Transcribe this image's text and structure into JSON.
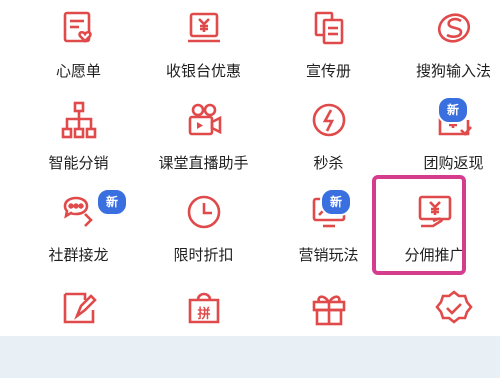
{
  "colors": {
    "icon": "#e04a4a",
    "badge": "#3a6fe0",
    "highlight": "#d63c8d"
  },
  "items": [
    {
      "label": "心愿单",
      "icon": "wishlist-icon"
    },
    {
      "label": "收银台优惠",
      "icon": "cashier-discount-icon"
    },
    {
      "label": "宣传册",
      "icon": "brochure-icon"
    },
    {
      "label": "搜狗输入法",
      "icon": "sogou-icon"
    },
    {
      "label": "智能分销",
      "icon": "smart-distribution-icon"
    },
    {
      "label": "课堂直播助手",
      "icon": "live-class-icon"
    },
    {
      "label": "秒杀",
      "icon": "flash-sale-icon"
    },
    {
      "label": "团购返现",
      "icon": "group-cashback-icon",
      "badge": "新"
    },
    {
      "label": "社群接龙",
      "icon": "community-relay-icon",
      "badge": "新"
    },
    {
      "label": "限时折扣",
      "icon": "timed-discount-icon"
    },
    {
      "label": "营销玩法",
      "icon": "marketing-icon",
      "badge": "新"
    },
    {
      "label": "分佣推广",
      "icon": "commission-promo-icon"
    },
    {
      "label": "",
      "icon": "edit-tag-icon"
    },
    {
      "label": "",
      "icon": "group-buy-icon",
      "glyph": "拼"
    },
    {
      "label": "",
      "icon": "gift-box-icon"
    },
    {
      "label": "",
      "icon": "badge-check-icon"
    }
  ]
}
